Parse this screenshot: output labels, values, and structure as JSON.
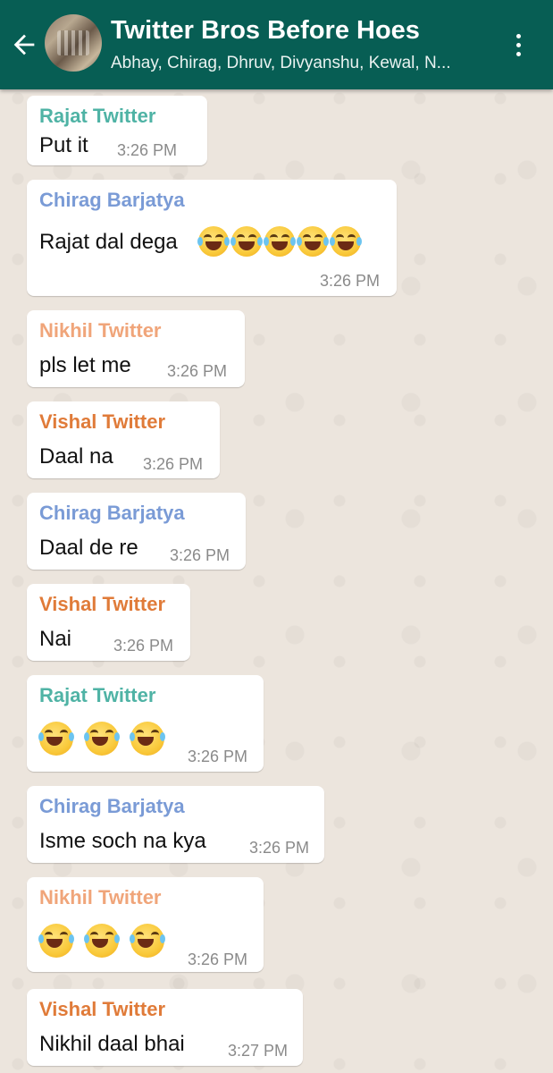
{
  "header": {
    "title": "Twitter Bros Before Hoes",
    "subtitle": "Abhay, Chirag, Dhruv, Divyanshu, Kewal, N...",
    "back_icon": "arrow-left-icon",
    "menu_icon": "more-vert-icon",
    "color": "#075e54"
  },
  "colors": {
    "rajat": "#4fb3a5",
    "chirag": "#7a9bd6",
    "nikhil": "#f0a57a",
    "vishal": "#e07b39"
  },
  "messages": [
    {
      "sender": "Rajat Twitter",
      "text": "Put it",
      "time": "3:26 PM"
    },
    {
      "sender": "Chirag Barjatya",
      "text": "Rajat dal dega",
      "emoji": "face-with-tears-of-joy",
      "emoji_count": 5,
      "time": "3:26 PM"
    },
    {
      "sender": "Nikhil Twitter",
      "text": "pls let me",
      "time": "3:26 PM"
    },
    {
      "sender": "Vishal Twitter",
      "text": "Daal na",
      "time": "3:26 PM"
    },
    {
      "sender": "Chirag Barjatya",
      "text": "Daal de re",
      "time": "3:26 PM"
    },
    {
      "sender": "Vishal Twitter",
      "text": "Nai",
      "time": "3:26 PM"
    },
    {
      "sender": "Rajat Twitter",
      "text": "",
      "emoji": "face-with-tears-of-joy",
      "emoji_count": 3,
      "time": "3:26 PM"
    },
    {
      "sender": "Chirag Barjatya",
      "text": "Isme soch na kya",
      "time": "3:26 PM"
    },
    {
      "sender": "Nikhil Twitter",
      "text": "",
      "emoji": "face-with-tears-of-joy",
      "emoji_count": 3,
      "time": "3:26 PM"
    },
    {
      "sender": "Vishal Twitter",
      "text": "Nikhil daal bhai",
      "time": "3:27 PM"
    }
  ]
}
